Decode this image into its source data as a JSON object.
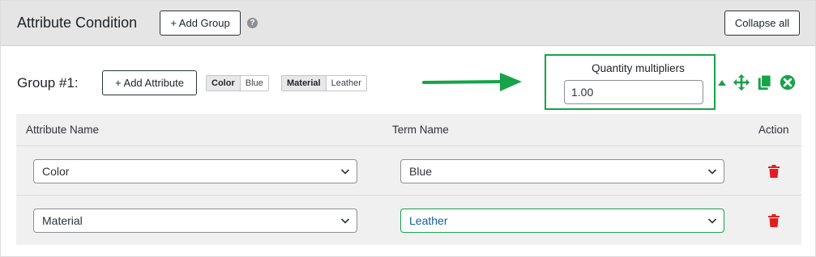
{
  "header": {
    "title": "Attribute Condition",
    "add_group_label": "+ Add Group",
    "help_glyph": "?",
    "collapse_all_label": "Collapse all"
  },
  "group": {
    "title": "Group #1:",
    "add_attribute_label": "+ Add Attribute",
    "chips": [
      {
        "key": "Color",
        "value": "Blue"
      },
      {
        "key": "Material",
        "value": "Leather"
      }
    ],
    "quantity_multiplier": {
      "label": "Quantity multipliers",
      "value": "1.00"
    },
    "icons": [
      "caret-up-icon",
      "move-icon",
      "copy-icon",
      "remove-icon"
    ],
    "accent_color": "#16a34a",
    "delete_color": "#e11d1d"
  },
  "table": {
    "headers": {
      "attribute": "Attribute Name",
      "term": "Term Name",
      "action": "Action"
    },
    "rows": [
      {
        "attribute": "Color",
        "term": "Blue"
      },
      {
        "attribute": "Material",
        "term": "Leather"
      }
    ]
  }
}
